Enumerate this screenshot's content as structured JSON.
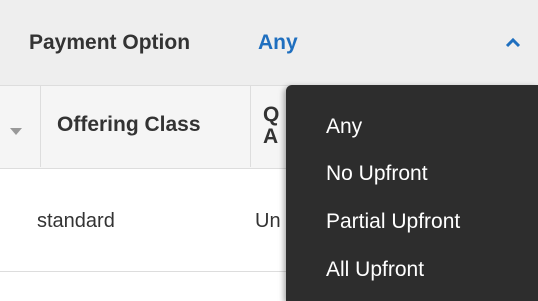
{
  "filter": {
    "label": "Payment Option",
    "value": "Any"
  },
  "table": {
    "columns": [
      "Offering Class",
      "Q A"
    ],
    "column_2_lines": [
      "Q",
      "A"
    ],
    "rows": [
      {
        "offering_class": "standard",
        "col2": "Un"
      }
    ]
  },
  "dropdown": {
    "options": [
      "Any",
      "No Upfront",
      "Partial Upfront",
      "All Upfront"
    ]
  },
  "colors": {
    "accent": "#1f6fbf",
    "dropdown_bg": "#2d2d2d",
    "header_bg": "#eeeeee"
  },
  "icons": {
    "collapse": "chevron-up-icon",
    "sort": "sort-down-icon"
  }
}
